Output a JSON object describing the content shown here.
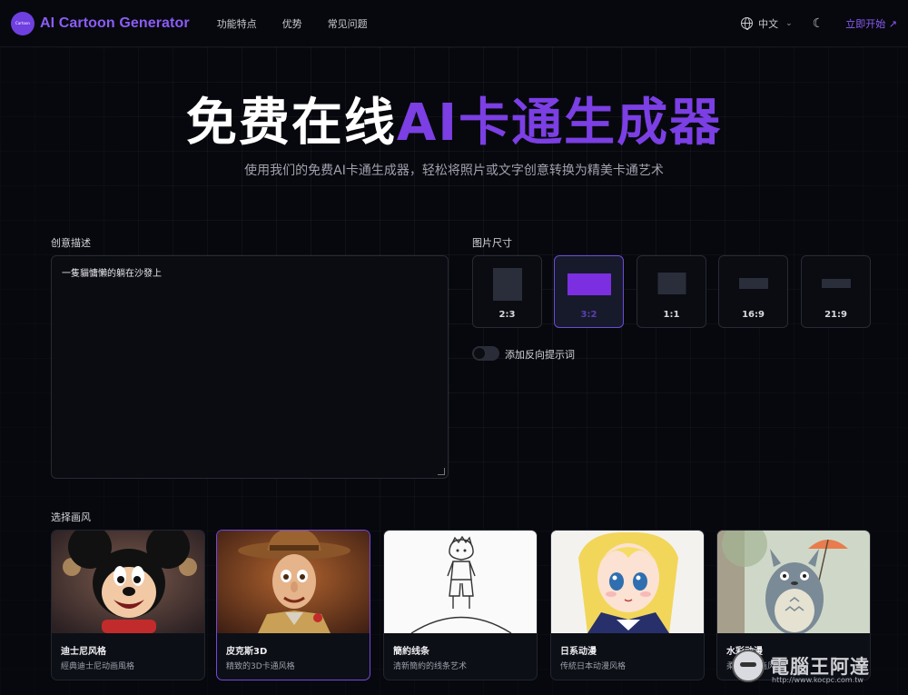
{
  "header": {
    "logo_badge_text": "Cartoon",
    "brand": "AI Cartoon Generator",
    "nav": [
      "功能特点",
      "优势",
      "常见问题"
    ],
    "language": "中文",
    "cta": "立即开始 ↗"
  },
  "hero": {
    "title_part1": "免费在线",
    "title_accent": "AI卡通生成器",
    "subtitle": "使用我们的免费AI卡通生成器，轻松将照片或文字创意转换为精美卡通艺术"
  },
  "prompt": {
    "label": "创意描述",
    "value": "一隻貓慵懶的躺在沙發上"
  },
  "sizes": {
    "label": "图片尺寸",
    "options": [
      "2:3",
      "3:2",
      "1:1",
      "16:9",
      "21:9"
    ],
    "selected": "3:2"
  },
  "negative_prompt": {
    "label": "添加反向提示词",
    "enabled": false
  },
  "styles": {
    "label": "选择画风",
    "selected": "皮克斯3D",
    "items": [
      {
        "name": "迪士尼风格",
        "desc": "經典迪士尼动画風格"
      },
      {
        "name": "皮克斯3D",
        "desc": "精致的3D卡通风格"
      },
      {
        "name": "簡約线条",
        "desc": "清新簡約的线条艺术"
      },
      {
        "name": "日系动漫",
        "desc": "传統日本动漫风格"
      },
      {
        "name": "水彩动漫",
        "desc": "柔和水彩画风"
      }
    ]
  },
  "colors": {
    "accent": "#7b3fe4",
    "background": "#07080d",
    "selected_border": "#6b4bd8"
  },
  "watermark": {
    "title": "電腦王阿達",
    "url": "http://www.kocpc.com.tw"
  }
}
